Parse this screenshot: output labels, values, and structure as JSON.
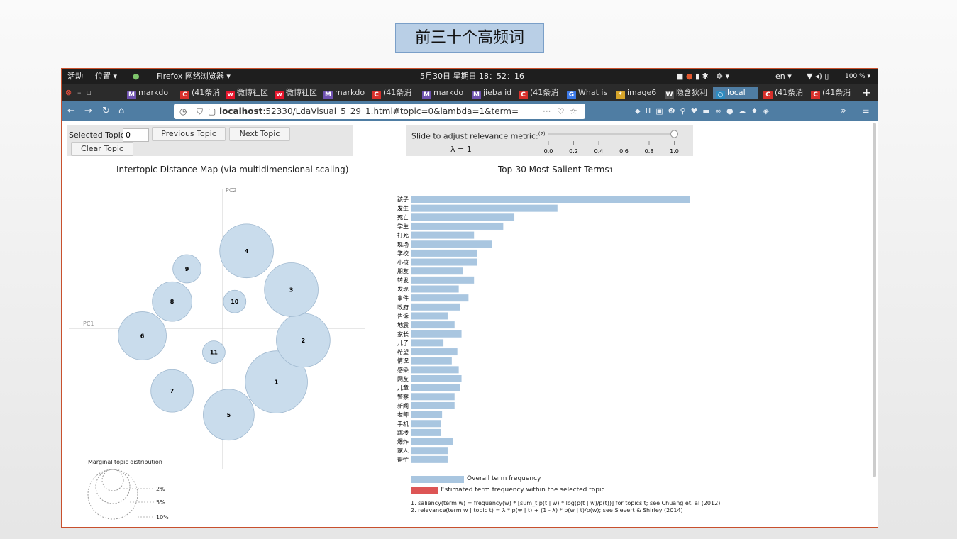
{
  "slide_title": "前三十个高频词",
  "gnome": {
    "activities": "活动",
    "places": "位置 ▾",
    "app": "Firefox 网络浏览器 ▾",
    "clock": "5月30日 星期日 18：52：16",
    "lang": "en ▾",
    "battery": "100 % ▾"
  },
  "tabs": [
    {
      "label": "markdo",
      "fav": "M",
      "color": "#6f52b0"
    },
    {
      "label": "(41条消",
      "fav": "C",
      "color": "#d8302b"
    },
    {
      "label": "微博社区",
      "fav": "w",
      "color": "#e6162d"
    },
    {
      "label": "微博社区",
      "fav": "w",
      "color": "#e6162d"
    },
    {
      "label": "markdo",
      "fav": "M",
      "color": "#6f52b0"
    },
    {
      "label": "(41条消",
      "fav": "C",
      "color": "#d8302b"
    },
    {
      "label": "markdo",
      "fav": "M",
      "color": "#6f52b0"
    },
    {
      "label": "jieba id",
      "fav": "M",
      "color": "#6f52b0"
    },
    {
      "label": "(41条消",
      "fav": "C",
      "color": "#d8302b"
    },
    {
      "label": "What is",
      "fav": "G",
      "color": "#3b78e7"
    },
    {
      "label": "image6",
      "fav": "*",
      "color": "#d6a52a"
    },
    {
      "label": "隐含狄利",
      "fav": "W",
      "color": "#555555"
    },
    {
      "label": "local",
      "fav": "○",
      "color": "#2e8bc0"
    },
    {
      "label": "(41条消",
      "fav": "C",
      "color": "#d8302b"
    },
    {
      "label": "(41条消",
      "fav": "C",
      "color": "#d8302b"
    }
  ],
  "url": {
    "host": "localhost",
    "rest": ":52330/LdaVisual_5_29_1.html#topic=0&lambda=1&term="
  },
  "controls": {
    "selected_topic_label": "Selected Topic:",
    "selected_topic_value": "0",
    "prev": "Previous Topic",
    "next": "Next Topic",
    "clear": "Clear Topic",
    "slider_label": "Slide to adjust relevance metric:",
    "slider_sup": "(2)",
    "lambda_text": "λ = 1",
    "lambda_value": 1,
    "ticks": [
      "0.0",
      "0.2",
      "0.4",
      "0.6",
      "0.8",
      "1.0"
    ]
  },
  "left_panel": {
    "title": "Intertopic Distance Map (via multidimensional scaling)",
    "pc1": "PC1",
    "pc2": "PC2",
    "marginal_title": "Marginal topic distribution",
    "marginal_labels": [
      "2%",
      "5%",
      "10%"
    ]
  },
  "right_panel": {
    "title": "Top-30 Most Salient Terms",
    "title_sup": "1",
    "legend_overall": "Overall term frequency",
    "legend_estimated": "Estimated term frequency within the selected topic",
    "footnote1": "1. saliency(term w) = frequency(w) * [sum_t p(t | w) * log(p(t | w)/p(t))] for topics t; see Chuang et. al (2012)",
    "footnote2": "2. relevance(term w | topic t) = λ * p(w | t) + (1 - λ) * p(w | t)/p(w); see Sievert & Shirley (2014)"
  },
  "colors": {
    "bar": "#a9c6e0",
    "estimated": "#dd5555",
    "bubble": "#c9dcec",
    "accent": "#4f7da3"
  },
  "chart_data": [
    {
      "type": "scatter",
      "title": "Intertopic Distance Map (via multidimensional scaling)",
      "xlabel": "PC1",
      "ylabel": "PC2",
      "points": [
        {
          "label": "1",
          "x": 0.18,
          "y": -0.18,
          "size": 0.11
        },
        {
          "label": "2",
          "x": 0.27,
          "y": -0.04,
          "size": 0.095
        },
        {
          "label": "3",
          "x": 0.23,
          "y": 0.13,
          "size": 0.095
        },
        {
          "label": "4",
          "x": 0.08,
          "y": 0.26,
          "size": 0.095
        },
        {
          "label": "5",
          "x": 0.02,
          "y": -0.29,
          "size": 0.09
        },
        {
          "label": "6",
          "x": -0.27,
          "y": -0.025,
          "size": 0.085
        },
        {
          "label": "7",
          "x": -0.17,
          "y": -0.21,
          "size": 0.075
        },
        {
          "label": "8",
          "x": -0.17,
          "y": 0.09,
          "size": 0.07
        },
        {
          "label": "9",
          "x": -0.12,
          "y": 0.2,
          "size": 0.05
        },
        {
          "label": "10",
          "x": 0.04,
          "y": 0.09,
          "size": 0.04
        },
        {
          "label": "11",
          "x": -0.03,
          "y": -0.08,
          "size": 0.04
        }
      ]
    },
    {
      "type": "bar",
      "title": "Top-30 Most Salient Terms",
      "categories": [
        "孩子",
        "发生",
        "死亡",
        "学生",
        "打死",
        "现场",
        "学校",
        "小孩",
        "朋友",
        "转发",
        "发现",
        "事件",
        "政府",
        "告诉",
        "地震",
        "家长",
        "儿子",
        "希望",
        "情况",
        "感染",
        "网友",
        "儿童",
        "警察",
        "新闻",
        "老师",
        "手机",
        "跳楼",
        "爆炸",
        "家人",
        "帮忙"
      ],
      "values": [
        1.0,
        0.525,
        0.37,
        0.33,
        0.225,
        0.29,
        0.235,
        0.235,
        0.185,
        0.225,
        0.17,
        0.205,
        0.175,
        0.13,
        0.155,
        0.18,
        0.115,
        0.165,
        0.145,
        0.17,
        0.18,
        0.175,
        0.155,
        0.155,
        0.11,
        0.105,
        0.105,
        0.15,
        0.13,
        0.13
      ],
      "xlim": [
        0,
        1
      ]
    }
  ]
}
